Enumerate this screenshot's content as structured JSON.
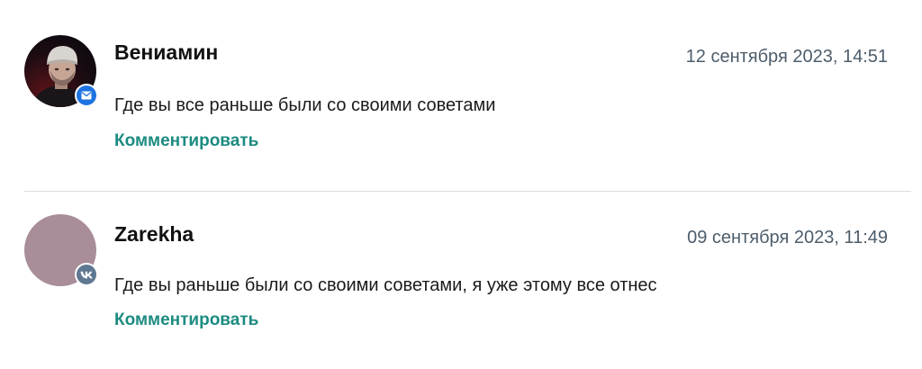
{
  "comments": [
    {
      "author": "Вениамин",
      "date": "12 сентября 2023, 14:51",
      "text": "Где вы все раньше были со своими советами",
      "reply_label": "Комментировать",
      "badge_icon": "mail-icon",
      "badge_color": "#1e73e0"
    },
    {
      "author": "Zarekha",
      "date": "09 сентября 2023, 11:49",
      "text": "Где вы раньше были со своими советами, я уже этому все отнес",
      "reply_label": "Комментировать",
      "badge_icon": "vk-icon",
      "badge_color": "#5f7891",
      "avatar_color": "#a98d99"
    }
  ],
  "accent_color": "#1b8b80"
}
